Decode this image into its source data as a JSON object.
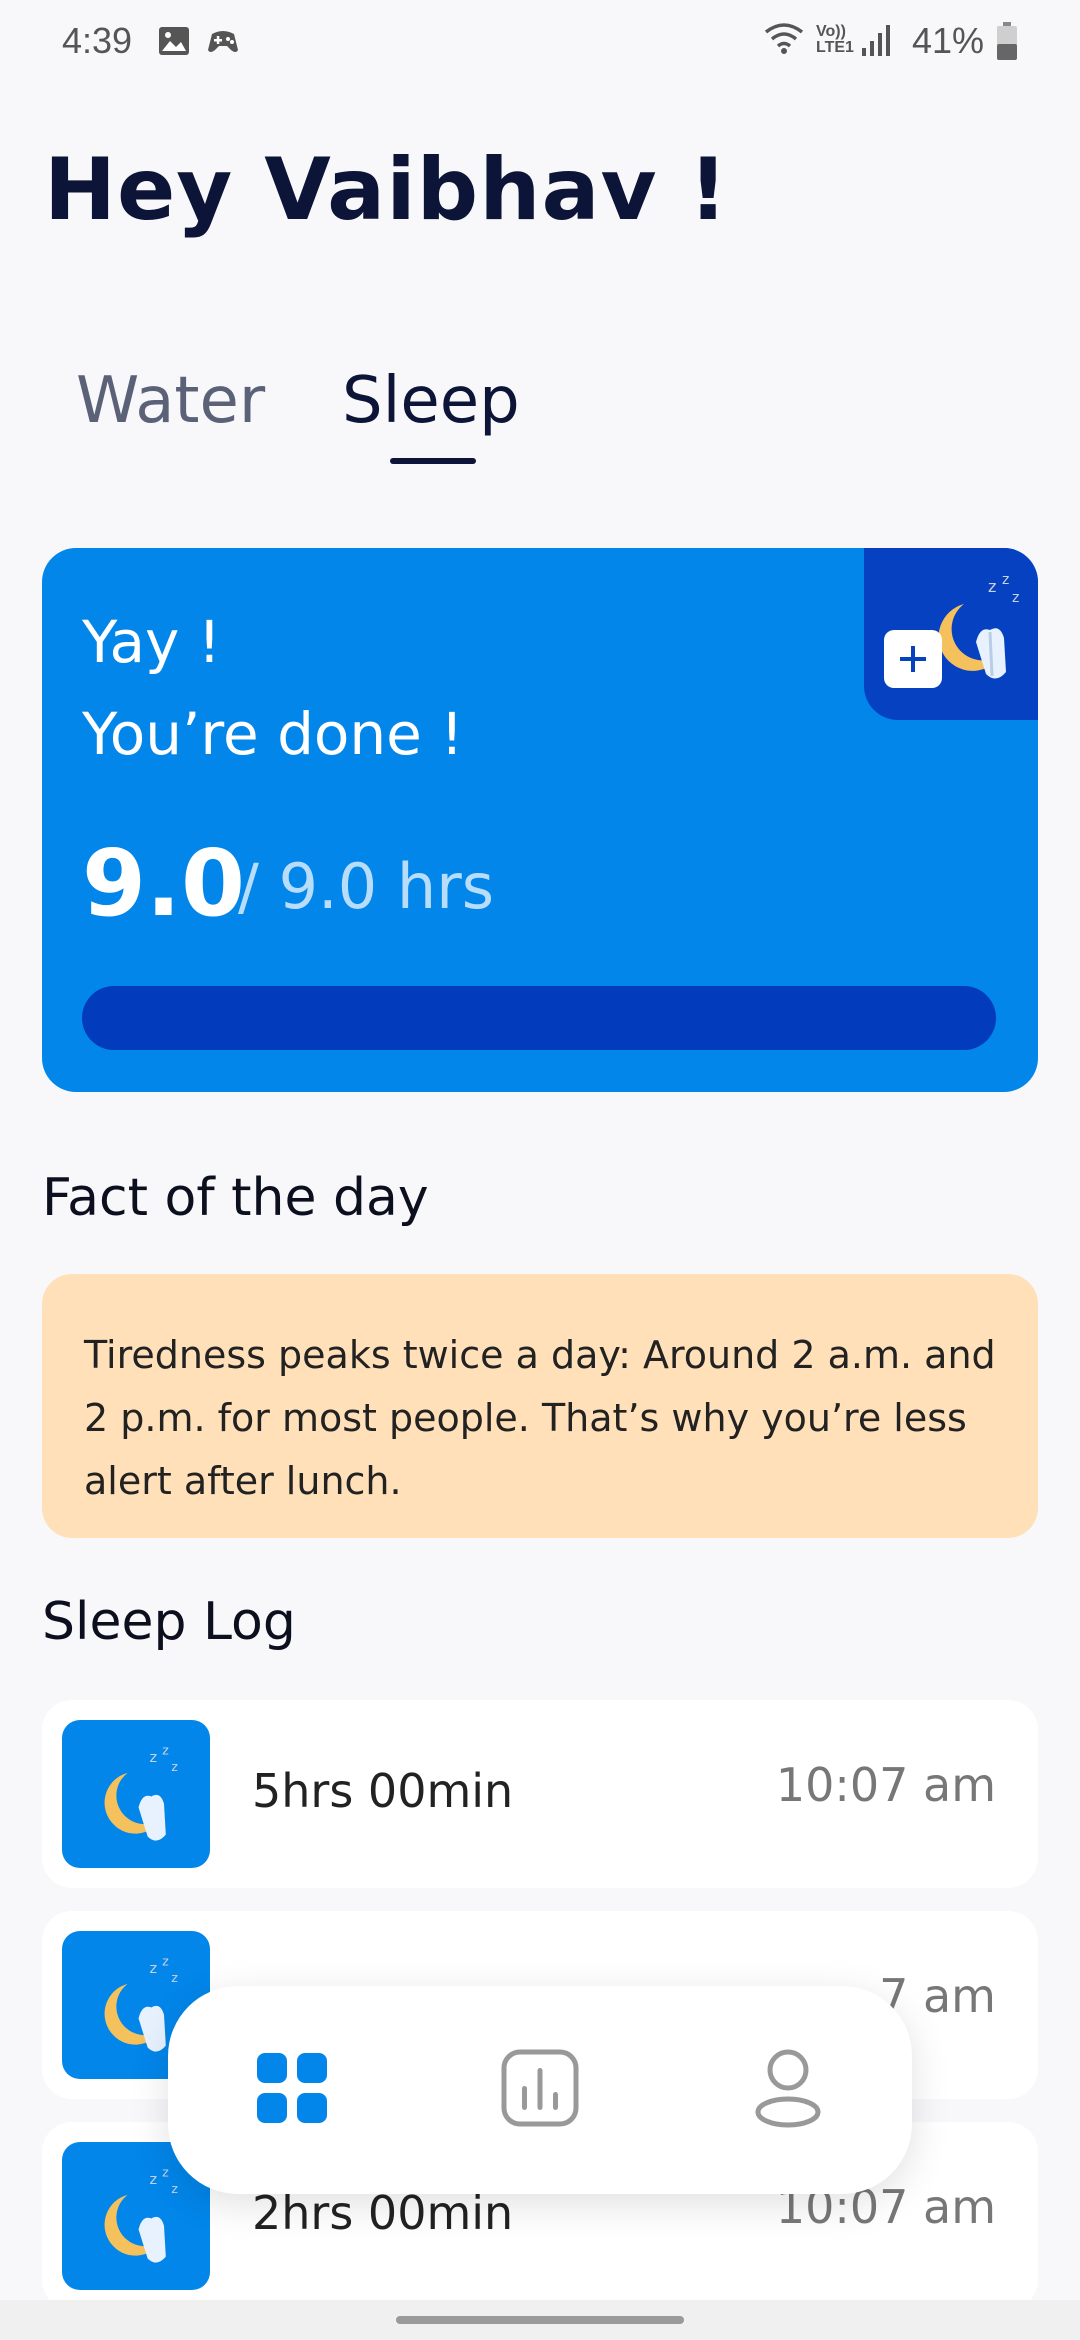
{
  "status_bar": {
    "time": "4:39",
    "battery": "41%",
    "network_label": "Vo))\nLTE1"
  },
  "greeting": "Hey Vaibhav !",
  "tabs": [
    {
      "label": "Water",
      "active": false
    },
    {
      "label": "Sleep",
      "active": true
    }
  ],
  "goal_card": {
    "line1": "Yay !",
    "line2": "You’re done !",
    "value": "9.0",
    "total": "/ 9.0 hrs",
    "progress": 1.0,
    "add_icon": "plus-icon",
    "illustration": "moon-sleep-icon"
  },
  "fact": {
    "title": "Fact of the day",
    "text": "Tiredness peaks twice a day: Around 2 a.m. and 2 p.m. for most people. That’s why you’re less alert after lunch."
  },
  "sleep_log": {
    "title": "Sleep Log",
    "items": [
      {
        "duration": "5hrs 00min",
        "time": "10:07 am"
      },
      {
        "duration": "",
        "time": "7 am"
      },
      {
        "duration": "2hrs 00min",
        "time": "10:07 am"
      }
    ]
  },
  "bottom_nav": {
    "items": [
      {
        "icon": "dashboard-grid-icon",
        "active": true
      },
      {
        "icon": "bar-chart-icon",
        "active": false
      },
      {
        "icon": "profile-icon",
        "active": false
      }
    ]
  },
  "colors": {
    "primary": "#0286ea",
    "primary_dark": "#033bbd",
    "fact_bg": "#ffe0b8",
    "background": "#f8f8fb",
    "text_dark": "#0c1437"
  }
}
